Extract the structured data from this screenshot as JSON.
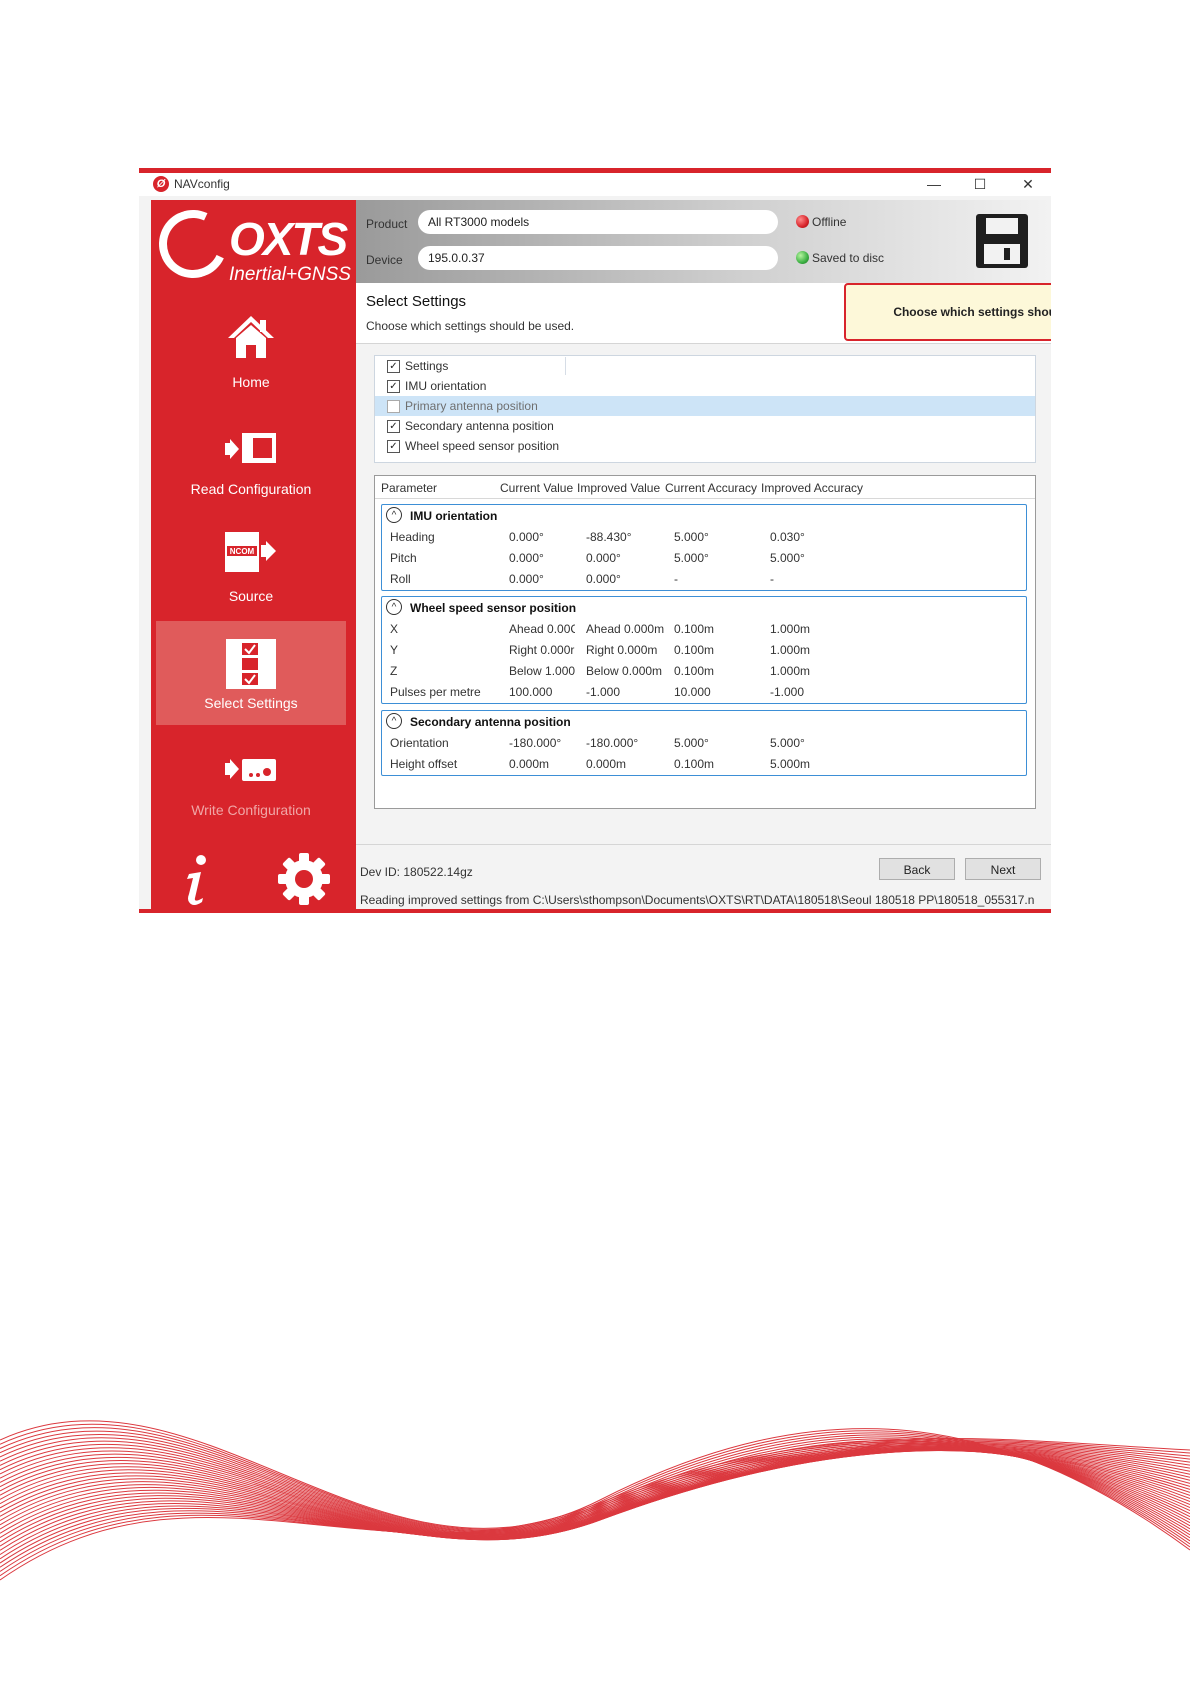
{
  "window": {
    "title": "NAVconfig",
    "controls": {
      "minimize": "—",
      "maximize": "☐",
      "close": "✕"
    }
  },
  "sidebar": {
    "logo": {
      "brand": "OXTS",
      "tagline": "Inertial+GNSS"
    },
    "items": [
      {
        "label": "Home",
        "icon": "home-icon",
        "active": false
      },
      {
        "label": "Read Configuration",
        "icon": "read-configuration-icon",
        "active": false
      },
      {
        "label": "Source",
        "icon": "ncom-source-icon",
        "active": false
      },
      {
        "label": "Select Settings",
        "icon": "select-settings-icon",
        "active": true
      },
      {
        "label": "Write Configuration",
        "icon": "write-configuration-icon",
        "active": false
      }
    ],
    "bottom_icons": [
      "info-icon",
      "gear-icon"
    ]
  },
  "topbar": {
    "product_label": "Product",
    "product_value": "All RT3000 models",
    "device_label": "Device",
    "device_value": "195.0.0.37",
    "status_offline": "Offline",
    "status_saved": "Saved to disc",
    "colors": {
      "offline": "#d8242b",
      "saved": "#3cb043"
    }
  },
  "header": {
    "title": "Select Settings",
    "subtitle": "Choose which settings should be used.",
    "hint": "Choose which settings should be improved."
  },
  "checklist": [
    {
      "label": "Settings",
      "checked": true
    },
    {
      "label": "IMU orientation",
      "checked": true
    },
    {
      "label": "Primary antenna position",
      "checked": false
    },
    {
      "label": "Secondary antenna position",
      "checked": true
    },
    {
      "label": "Wheel speed sensor position",
      "checked": true
    }
  ],
  "grid": {
    "columns": [
      "Parameter",
      "Current Value",
      "Improved Value",
      "Current Accuracy",
      "Improved Accuracy"
    ],
    "groups": [
      {
        "title": "IMU orientation",
        "rows": [
          [
            "Heading",
            "0.000°",
            "-88.430°",
            "5.000°",
            "0.030°"
          ],
          [
            "Pitch",
            "0.000°",
            "0.000°",
            "5.000°",
            "5.000°"
          ],
          [
            "Roll",
            "0.000°",
            "0.000°",
            "-",
            "-"
          ]
        ]
      },
      {
        "title": "Wheel speed sensor position",
        "rows": [
          [
            "X",
            "Ahead 0.00C",
            "Ahead 0.000m",
            "0.100m",
            "1.000m"
          ],
          [
            "Y",
            "Right 0.000r",
            "Right 0.000m",
            "0.100m",
            "1.000m"
          ],
          [
            "Z",
            "Below 1.000",
            "Below 0.000m",
            "0.100m",
            "1.000m"
          ],
          [
            "Pulses per metre",
            "100.000",
            "-1.000",
            "10.000",
            "-1.000"
          ]
        ]
      },
      {
        "title": "Secondary antenna position",
        "rows": [
          [
            "Orientation",
            "-180.000°",
            "-180.000°",
            "5.000°",
            "5.000°"
          ],
          [
            "Height offset",
            "0.000m",
            "0.000m",
            "0.100m",
            "5.000m"
          ]
        ]
      }
    ]
  },
  "footer": {
    "dev_id": "Dev ID: 180522.14gz",
    "back_label": "Back",
    "next_label": "Next",
    "status_line": "Reading improved settings from C:\\Users\\sthompson\\Documents\\OXTS\\RT\\DATA\\180518\\Seoul 180518 PP\\180518_055317.n"
  },
  "brand_color": "#d8242b"
}
